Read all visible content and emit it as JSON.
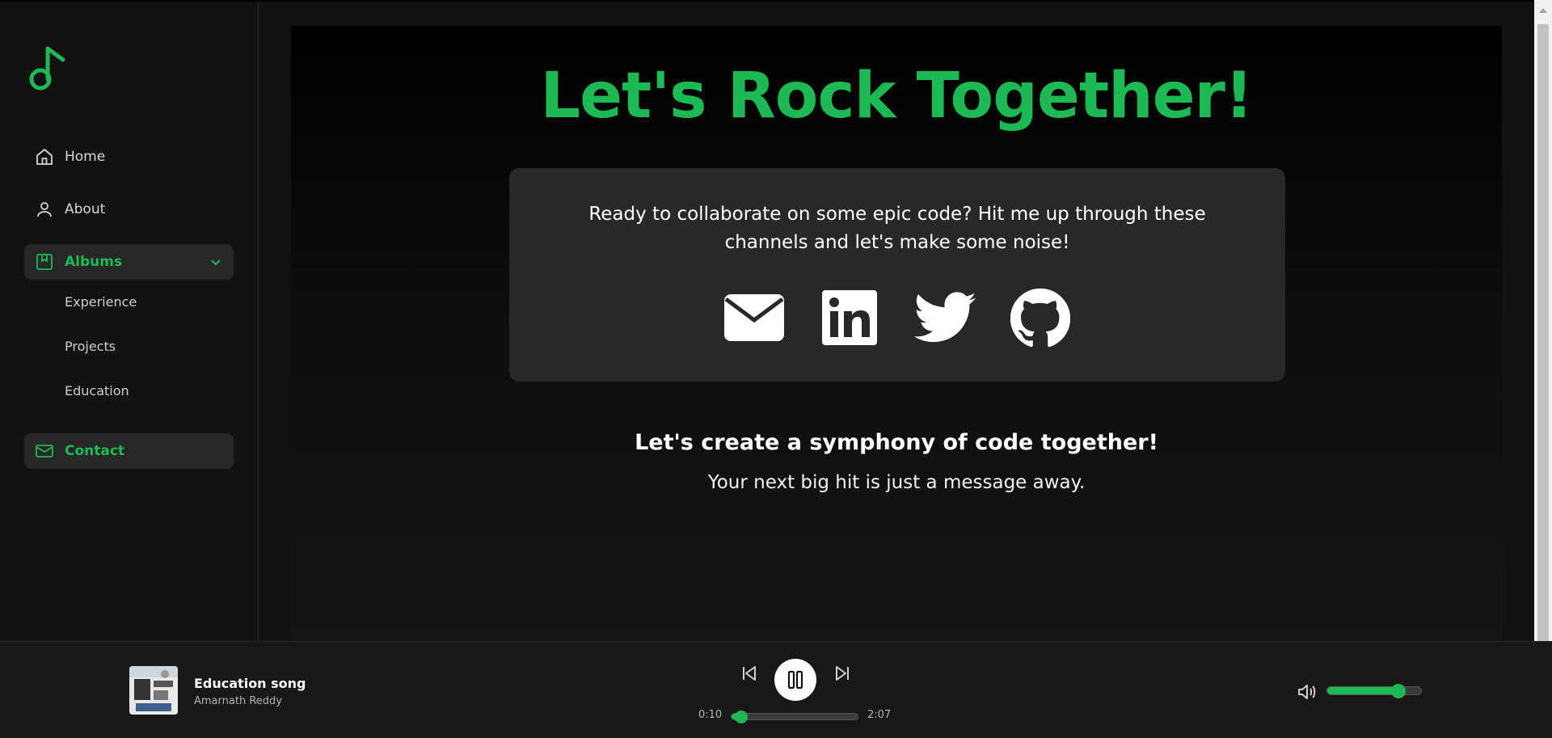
{
  "colors": {
    "accent": "#1db954",
    "background": "#121212",
    "card": "#282828",
    "player": "#181818"
  },
  "sidebar": {
    "logo_icon": "music-note-icon",
    "items": [
      {
        "label": "Home",
        "icon": "home-icon"
      },
      {
        "label": "About",
        "icon": "user-icon"
      },
      {
        "label": "Albums",
        "icon": "bookmark-icon",
        "expanded": true
      },
      {
        "label": "Contact",
        "icon": "mail-icon",
        "active": true
      }
    ],
    "albums_sub": [
      "Experience",
      "Projects",
      "Education"
    ]
  },
  "main": {
    "headline": "Let's Rock Together!",
    "card_text": "Ready to collaborate on some epic code? Hit me up through these channels and let's make some noise!",
    "socials": [
      "email-icon",
      "linkedin-icon",
      "twitter-icon",
      "github-icon"
    ],
    "tagline": "Let's create a symphony of code together!",
    "subline": "Your next big hit is just a message away."
  },
  "player": {
    "song_title": "Education song",
    "artist": "Amarnath Reddy",
    "current_time": "0:10",
    "total_time": "2:07",
    "progress": 0.08,
    "volume": 0.76,
    "state": "playing"
  }
}
